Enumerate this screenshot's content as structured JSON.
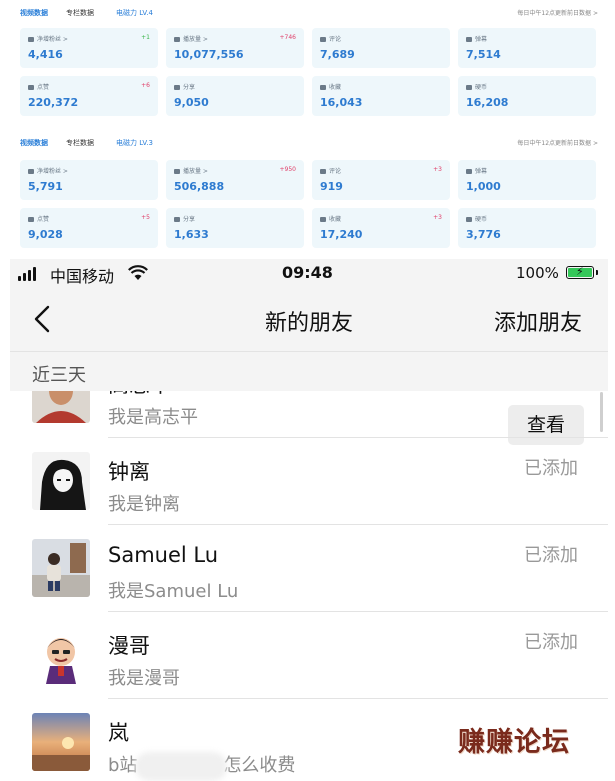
{
  "dashboards": [
    {
      "tabs": [
        "视频数据",
        "专栏数据"
      ],
      "level": "电磁力 LV.4",
      "note": "每日中午12点更新前日数据 >",
      "cards": [
        {
          "label": "净增粉丝 >",
          "value": "4,416",
          "delta": "+1",
          "delta_color": "#3bb54a",
          "icon": "user-icon"
        },
        {
          "label": "播放量 >",
          "value": "10,077,556",
          "delta": "+746",
          "delta_color": "#e0406a",
          "icon": "play-icon"
        },
        {
          "label": "评论",
          "value": "7,689",
          "delta": "",
          "delta_color": "#e0406a",
          "icon": "comment-icon"
        },
        {
          "label": "弹幕",
          "value": "7,514",
          "delta": "",
          "delta_color": "#e0406a",
          "icon": "danmaku-icon"
        },
        {
          "label": "点赞",
          "value": "220,372",
          "delta": "+6",
          "delta_color": "#e0406a",
          "icon": "like-icon"
        },
        {
          "label": "分享",
          "value": "9,050",
          "delta": "",
          "delta_color": "#e0406a",
          "icon": "share-icon"
        },
        {
          "label": "收藏",
          "value": "16,043",
          "delta": "",
          "delta_color": "#e0406a",
          "icon": "star-icon"
        },
        {
          "label": "硬币",
          "value": "16,208",
          "delta": "",
          "delta_color": "#e0406a",
          "icon": "coin-icon"
        }
      ]
    },
    {
      "tabs": [
        "视频数据",
        "专栏数据"
      ],
      "level": "电磁力 LV.3",
      "note": "每日中午12点更新前日数据 >",
      "cards": [
        {
          "label": "净增粉丝 >",
          "value": "5,791",
          "delta": "",
          "delta_color": "#e0406a",
          "icon": "user-icon"
        },
        {
          "label": "播放量 >",
          "value": "506,888",
          "delta": "+950",
          "delta_color": "#e0406a",
          "icon": "play-icon"
        },
        {
          "label": "评论",
          "value": "919",
          "delta": "+3",
          "delta_color": "#e0406a",
          "icon": "comment-icon"
        },
        {
          "label": "弹幕",
          "value": "1,000",
          "delta": "",
          "delta_color": "#e0406a",
          "icon": "danmaku-icon"
        },
        {
          "label": "点赞",
          "value": "9,028",
          "delta": "+5",
          "delta_color": "#e0406a",
          "icon": "like-icon"
        },
        {
          "label": "分享",
          "value": "1,633",
          "delta": "",
          "delta_color": "#e0406a",
          "icon": "share-icon"
        },
        {
          "label": "收藏",
          "value": "17,240",
          "delta": "+3",
          "delta_color": "#e0406a",
          "icon": "star-icon"
        },
        {
          "label": "硬币",
          "value": "3,776",
          "delta": "",
          "delta_color": "#e0406a",
          "icon": "coin-icon"
        }
      ]
    }
  ],
  "status_bar": {
    "carrier": "中国移动",
    "time": "09:48",
    "battery": "100%",
    "battery_color": "#34c759"
  },
  "nav": {
    "title": "新的朋友",
    "action": "添加朋友",
    "back_icon": "chevron-left-icon"
  },
  "section_header": "近三天",
  "friends": [
    {
      "name": "高志平",
      "intro": "我是高志平",
      "status": "查看",
      "is_button": true,
      "avatar": "avatar-man-photo"
    },
    {
      "name": "钟离",
      "intro": "我是钟离",
      "status": "已添加",
      "is_button": false,
      "avatar": "avatar-anime-sketch"
    },
    {
      "name": "Samuel Lu",
      "intro": "我是Samuel Lu",
      "status": "已添加",
      "is_button": false,
      "avatar": "avatar-child-photo"
    },
    {
      "name": "漫哥",
      "intro": "我是漫哥",
      "status": "已添加",
      "is_button": false,
      "avatar": "avatar-cartoon"
    },
    {
      "name": "岚",
      "intro": "b站",
      "intro_tail": "怎么收费",
      "status": "",
      "is_button": false,
      "avatar": "avatar-sunset"
    }
  ],
  "watermark": "赚赚论坛"
}
